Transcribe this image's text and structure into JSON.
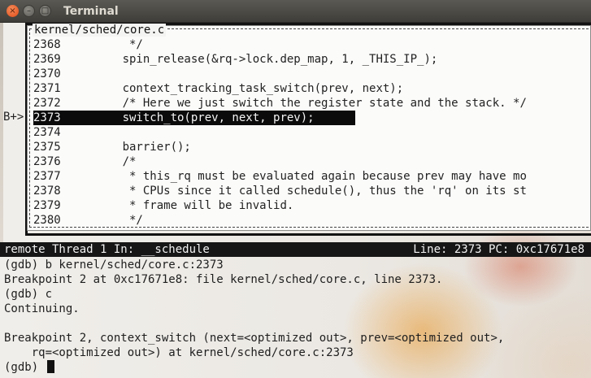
{
  "window": {
    "title": "Terminal",
    "buttons": {
      "close": "×",
      "minimize": "–",
      "maximize": "□"
    }
  },
  "source": {
    "filename": "kernel/sched/core.c",
    "breakpoint_marker": "B+>",
    "lines": [
      {
        "num": "2368",
        "code": "          */"
      },
      {
        "num": "2369",
        "code": "         spin_release(&rq->lock.dep_map, 1, _THIS_IP_);"
      },
      {
        "num": "2370",
        "code": ""
      },
      {
        "num": "2371",
        "code": "         context_tracking_task_switch(prev, next);"
      },
      {
        "num": "2372",
        "code": "         /* Here we just switch the register state and the stack. */"
      },
      {
        "num": "2373",
        "code": "         switch_to(prev, next, prev);"
      },
      {
        "num": "2374",
        "code": ""
      },
      {
        "num": "2375",
        "code": "         barrier();"
      },
      {
        "num": "2376",
        "code": "         /*"
      },
      {
        "num": "2377",
        "code": "          * this_rq must be evaluated again because prev may have mo"
      },
      {
        "num": "2378",
        "code": "          * CPUs since it called schedule(), thus the 'rq' on its st"
      },
      {
        "num": "2379",
        "code": "          * frame will be invalid."
      },
      {
        "num": "2380",
        "code": "          */"
      }
    ]
  },
  "status": {
    "left": "remote Thread 1 In: __schedule",
    "right": "Line: 2373 PC: 0xc17671e8"
  },
  "console": {
    "lines": [
      "(gdb) b kernel/sched/core.c:2373",
      "Breakpoint 2 at 0xc17671e8: file kernel/sched/core.c, line 2373.",
      "(gdb) c",
      "Continuing.",
      "",
      "Breakpoint 2, context_switch (next=<optimized out>, prev=<optimized out>,",
      "    rq=<optimized out>) at kernel/sched/core.c:2373"
    ],
    "prompt": "(gdb) "
  }
}
